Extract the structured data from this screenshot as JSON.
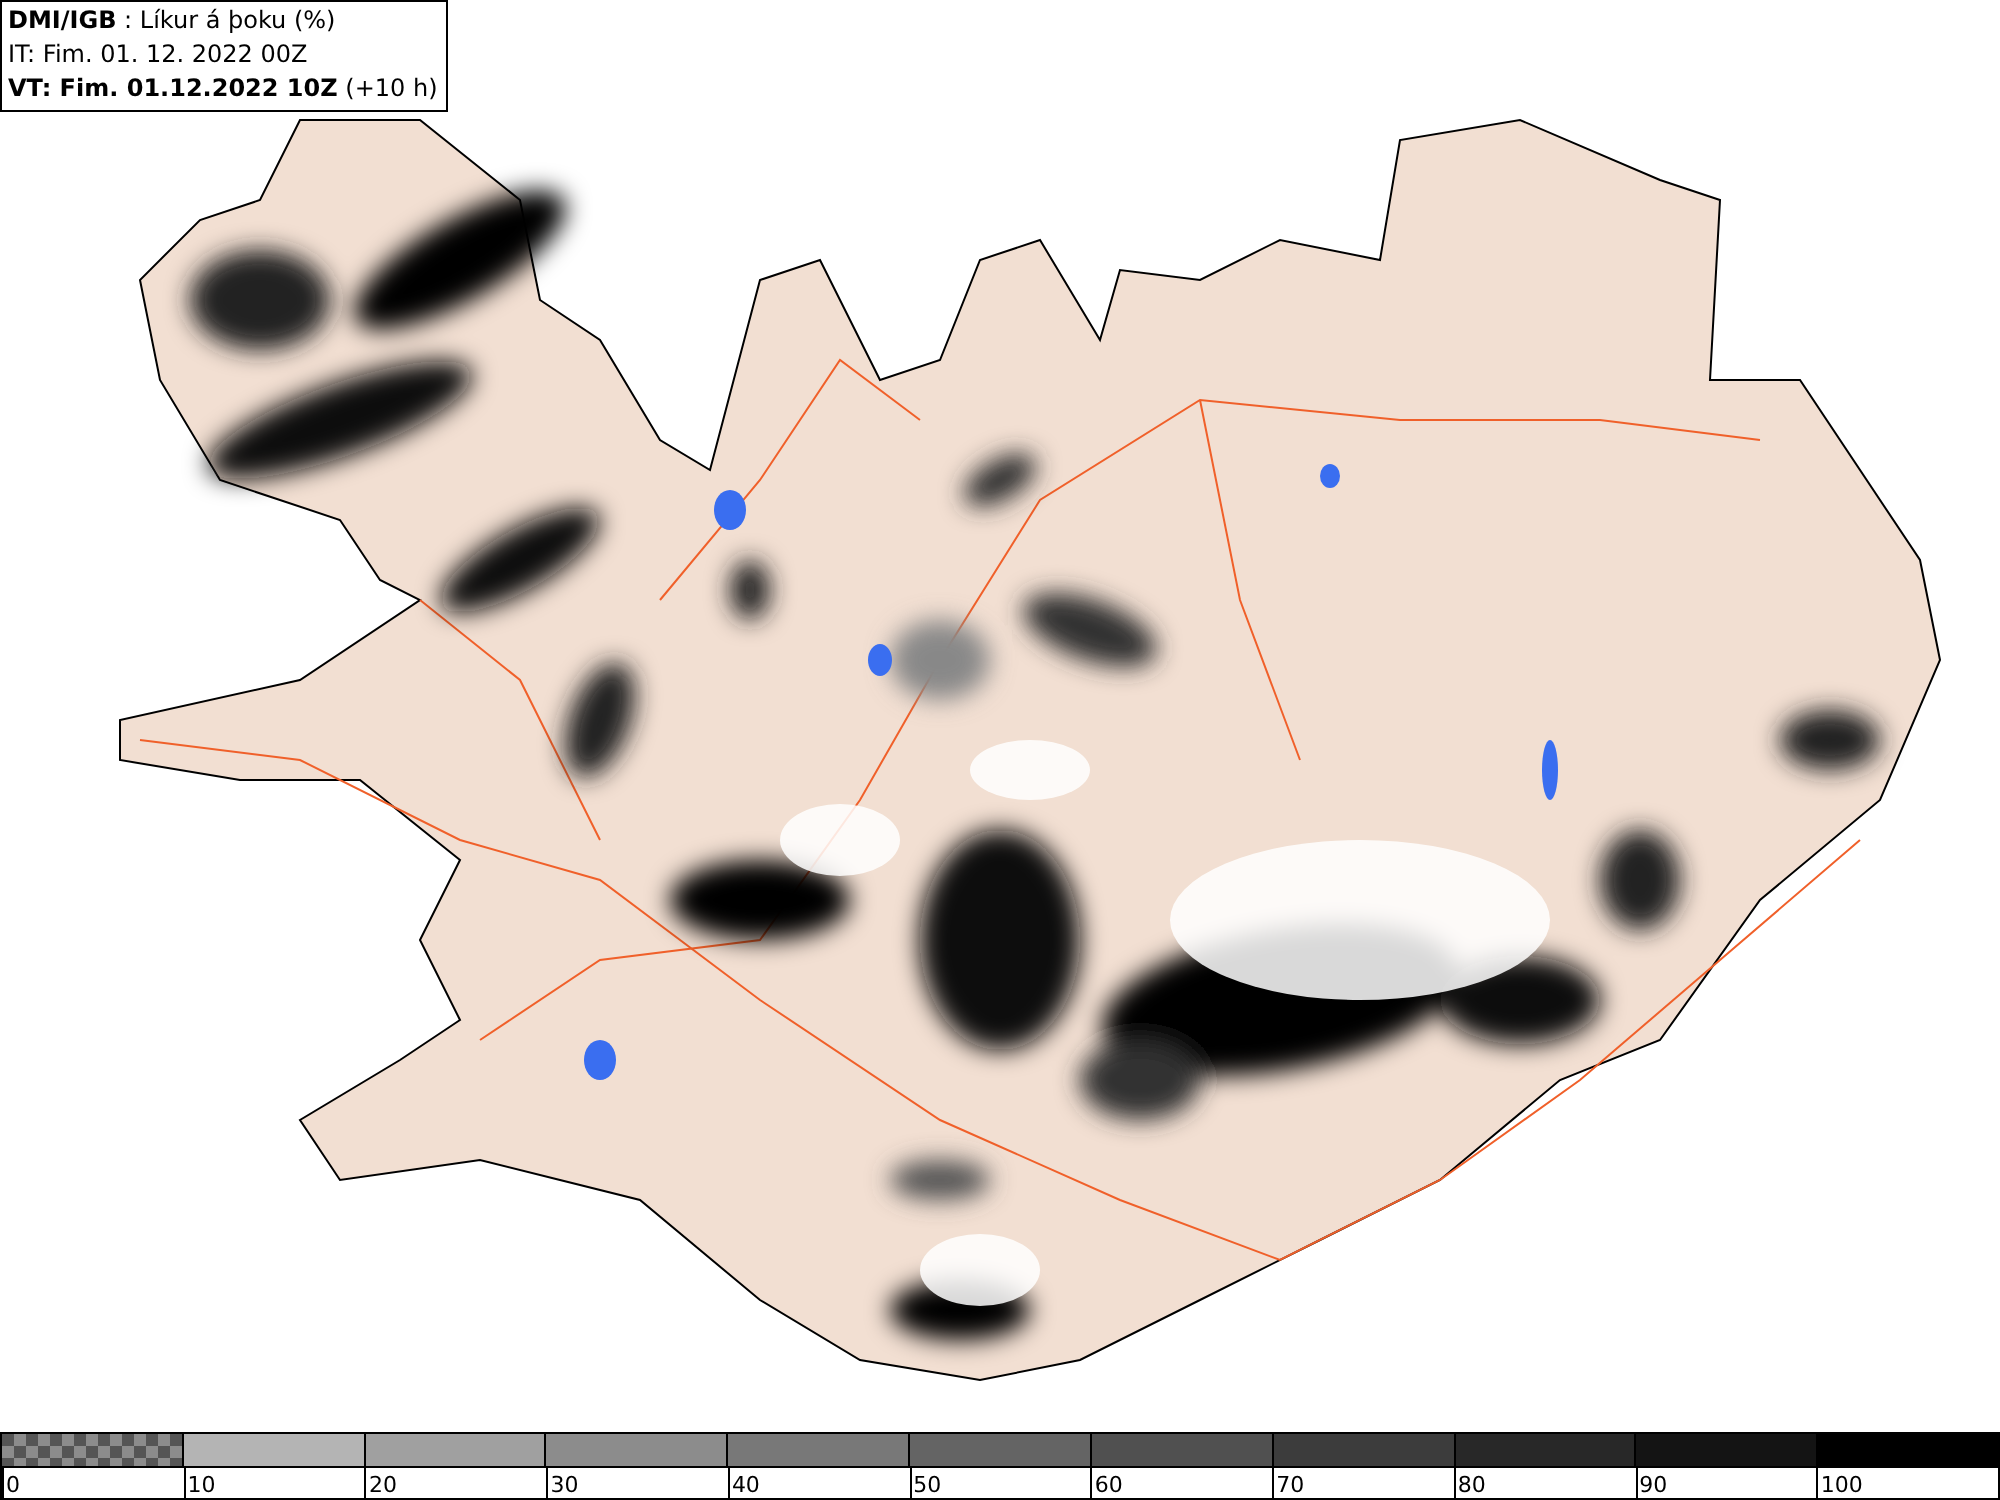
{
  "header": {
    "lines": [
      "**DMI/IGB** : Líkur á þoku (%)",
      "IT: Fim. 01. 12. 2022 00Z",
      "**VT: Fim. 01.12.2022 10Z** (+10 h)"
    ]
  },
  "colorbar": {
    "bins": [
      {
        "kind": "checker",
        "color": "#8c8c8c"
      },
      {
        "kind": "solid",
        "color": "#b4b4b4"
      },
      {
        "kind": "solid",
        "color": "#a0a0a0"
      },
      {
        "kind": "solid",
        "color": "#8c8c8c"
      },
      {
        "kind": "solid",
        "color": "#787878"
      },
      {
        "kind": "solid",
        "color": "#646464"
      },
      {
        "kind": "solid",
        "color": "#505050"
      },
      {
        "kind": "solid",
        "color": "#3c3c3c"
      },
      {
        "kind": "solid",
        "color": "#282828"
      },
      {
        "kind": "solid",
        "color": "#141414"
      },
      {
        "kind": "solid",
        "color": "#000000"
      }
    ],
    "ticks": [
      "0",
      "10",
      "20",
      "30",
      "40",
      "50",
      "60",
      "70",
      "80",
      "90",
      "100"
    ]
  }
}
